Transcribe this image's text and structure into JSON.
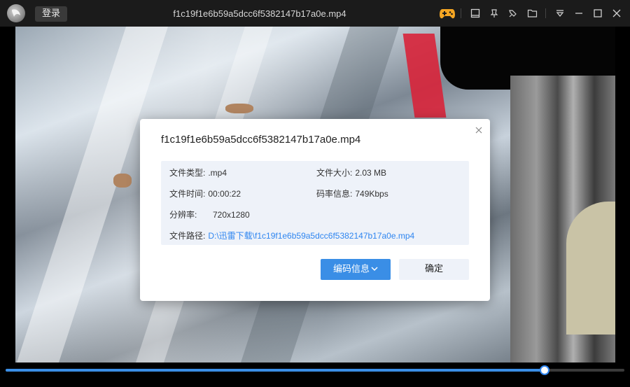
{
  "window": {
    "title": "f1c19f1e6b59a5dcc6f5382147b17a0e.mp4",
    "login_label": "登录"
  },
  "toolbar_icons": [
    "gamepad-icon",
    "window-icon",
    "pin-icon",
    "folder-pin-icon",
    "folder-icon",
    "dropdown-icon",
    "minimize-icon",
    "maximize-icon",
    "close-icon"
  ],
  "colors": {
    "accent": "#3a8ee6",
    "gamepad": "#f5a623",
    "info_bg": "#eef2f9",
    "link": "#2f86f0"
  },
  "dialog": {
    "title": "f1c19f1e6b59a5dcc6f5382147b17a0e.mp4",
    "rows": {
      "type_label": "文件类型:",
      "type_value": ".mp4",
      "size_label": "文件大小:",
      "size_value": "2.03 MB",
      "duration_label": "文件时间:",
      "duration_value": "00:00:22",
      "bitrate_label": "码率信息:",
      "bitrate_value": "749Kbps",
      "resolution_label": "分辨率:",
      "resolution_value": "720x1280",
      "path_label": "文件路径:",
      "path_value": "D:\\迅雷下载\\f1c19f1e6b59a5dcc6f5382147b17a0e.mp4"
    },
    "encode_button": "编码信息",
    "ok_button": "确定"
  },
  "playback": {
    "progress": 0.871
  }
}
